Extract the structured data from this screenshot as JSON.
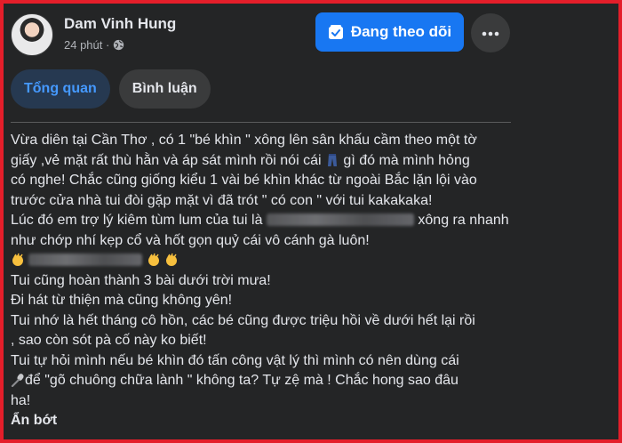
{
  "post": {
    "author": "Dam Vinh Hung",
    "time": "24 phút ·",
    "follow_label": "Đang theo dõi",
    "tabs": [
      {
        "label": "Tổng quan",
        "active": true
      },
      {
        "label": "Bình luận",
        "active": false
      }
    ],
    "lines": {
      "l1": "Vừa diên tại Cần Thơ , có 1 \"bé khìn \" xông lên sân khấu cầm theo một tờ",
      "l2": "giấy ,vẻ mặt rất thù hằn và áp sát mình rồi nói cái",
      "l2b": "gì đó mà mình hỏng",
      "l3": "có nghe! Chắc cũng giống kiểu 1 vài bé khìn khác từ ngoài Bắc lặn lội vào",
      "l4": "trước cửa nhà tui đòi gặp mặt vì đã trót \" có con \" với tui kakakaka!",
      "l5": "Lúc đó em trợ lý kiêm tùm lum của tui là",
      "l5b": "xông ra nhanh",
      "l6": "như chớp nhí kẹp cổ và hốt gọn quỷ cái vô cánh gà luôn!",
      "l8": "Tui cũng hoàn thành 3 bài dưới trời mưa!",
      "l9": "Đi hát từ thiện mà cũng không yên!",
      "l10": "Tui nhớ là hết tháng cô hồn, các bé cũng được triệu hồi về dưới hết lại rồi",
      "l11": ", sao còn sót pà cố này ko biết!",
      "l12": "Tui tự hỏi mình nếu bé khìn đó tấn công vật lý thì mình có nên dùng cái",
      "l13": "để \"gõ chuông chữa lành \" không ta? Tự zệ mà ! Chắc hong sao đâu",
      "l14": "ha!"
    },
    "see_less": "Ẩn bớt"
  },
  "colors": {
    "background": "#242526",
    "accent": "#1877f2",
    "frame": "#e41e2a",
    "active_tab_text": "#4599ff"
  },
  "icons": [
    "globe-icon",
    "follow-check-icon",
    "more-icon",
    "jeans-emoji-icon",
    "clap-emoji-icon",
    "microphone-emoji-icon"
  ]
}
